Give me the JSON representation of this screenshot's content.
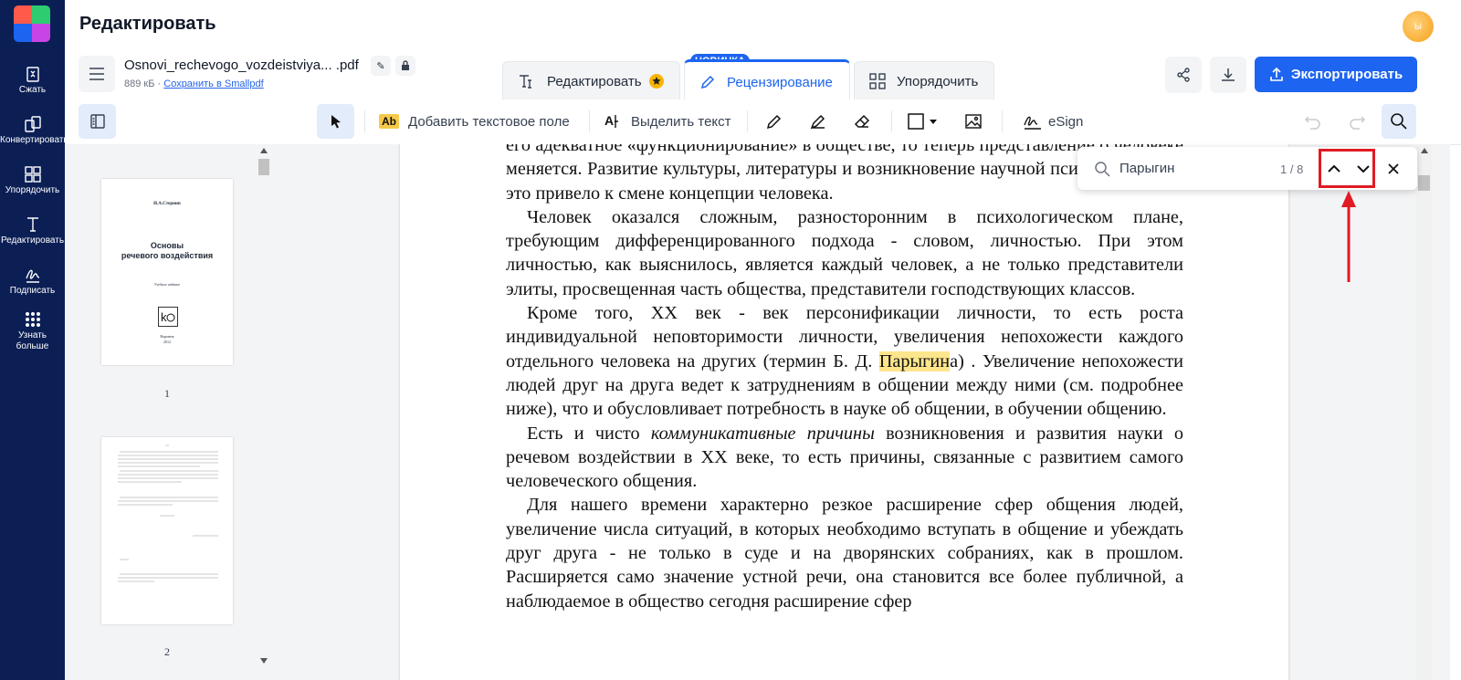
{
  "sidebar_nav": {
    "items": [
      {
        "label": "Сжать",
        "icon": "compress-icon"
      },
      {
        "label": "Конвертировать",
        "icon": "convert-icon"
      },
      {
        "label": "Упорядочить",
        "icon": "organize-icon"
      },
      {
        "label": "Редактировать",
        "icon": "edit-text-icon"
      },
      {
        "label": "Подписать",
        "icon": "sign-icon"
      },
      {
        "label": "Узнать больше",
        "icon": "more-icon"
      }
    ]
  },
  "header": {
    "title": "Редактировать",
    "avatar_text": "Ы"
  },
  "file": {
    "name": "Osnovi_rechevogo_vozdeistviya...",
    "ext": ".pdf",
    "size": "889 кБ",
    "separator": "·",
    "save_link": "Сохранить в Smallpdf"
  },
  "tabs": [
    {
      "label": "Редактировать",
      "badge": "НОВИНКА"
    },
    {
      "label": "Рецензирование"
    },
    {
      "label": "Упорядочить"
    }
  ],
  "actions": {
    "export_label": "Экспортировать"
  },
  "toolbar": {
    "add_text_label": "Добавить текстовое поле",
    "add_text_icon_text": "Ab",
    "highlight_label": "Выделить текст",
    "esign_label": "eSign"
  },
  "thumbnails": {
    "page1": {
      "author": "И.А.Стернин",
      "title_line1": "Основы",
      "title_line2": "речевого воздействия",
      "subtitle": "Учебное издание",
      "city": "Воронеж",
      "year": "2012",
      "number": "1"
    },
    "page2": {
      "number": "2"
    }
  },
  "document": {
    "paragraphs": [
      {
        "indent": false,
        "parts": [
          {
            "t": "его адекватное «функционирование» в обществе, то теперь представление о человеке меняется. Развитие культуры, литературы и возникновение научной психологии  -  все это привело к смене концепции человека."
          }
        ]
      },
      {
        "indent": true,
        "parts": [
          {
            "t": "Человек оказался сложным, разносторонним в психологическом плане, требующим дифференцированного подхода - словом, личностью. При этом личностью, как выяснилось, является каждый человек, а не только представители элиты, просвещенная часть общества, представители господствующих классов."
          }
        ]
      },
      {
        "indent": true,
        "parts": [
          {
            "t": "Кроме того, XX век - век персонификации личности, то есть роста индивидуальной неповторимости личности, увеличения непохожести каждого отдельного человека на других (термин Б. Д. "
          },
          {
            "t": "Парыгин",
            "hl": true
          },
          {
            "t": "а) . Увеличение непохожести людей друг на друга ведет к затруднениям в общении между ними (см. подробнее ниже), что и обусловливает потребность в науке об общении, в обучении общению."
          }
        ]
      },
      {
        "indent": true,
        "parts": [
          {
            "t": "Есть и чисто "
          },
          {
            "t": "коммуникативные причины",
            "i": true
          },
          {
            "t": " возникновения и развития науки о речевом воздействии в XX веке, то есть причины, связанные с развитием самого человеческого общения."
          }
        ]
      },
      {
        "indent": true,
        "parts": [
          {
            "t": "Для нашего времени характерно резкое расширение сфер общения людей, увеличение числа ситуаций, в которых необходимо вступать в общение и убеждать друг друга - не только в суде и на дворянских собраниях, как в прошлом. Расширяется само значение устной  речи, она становится все более публичной, а наблюдаемое в общество сегодня расширение сфер"
          }
        ]
      }
    ]
  },
  "search": {
    "query": "Парыгин",
    "count": "1 / 8"
  },
  "colors": {
    "nav_bg": "#0b1f55",
    "accent": "#1d64f0",
    "highlight": "#fde58c",
    "annotation": "#e01b24"
  }
}
